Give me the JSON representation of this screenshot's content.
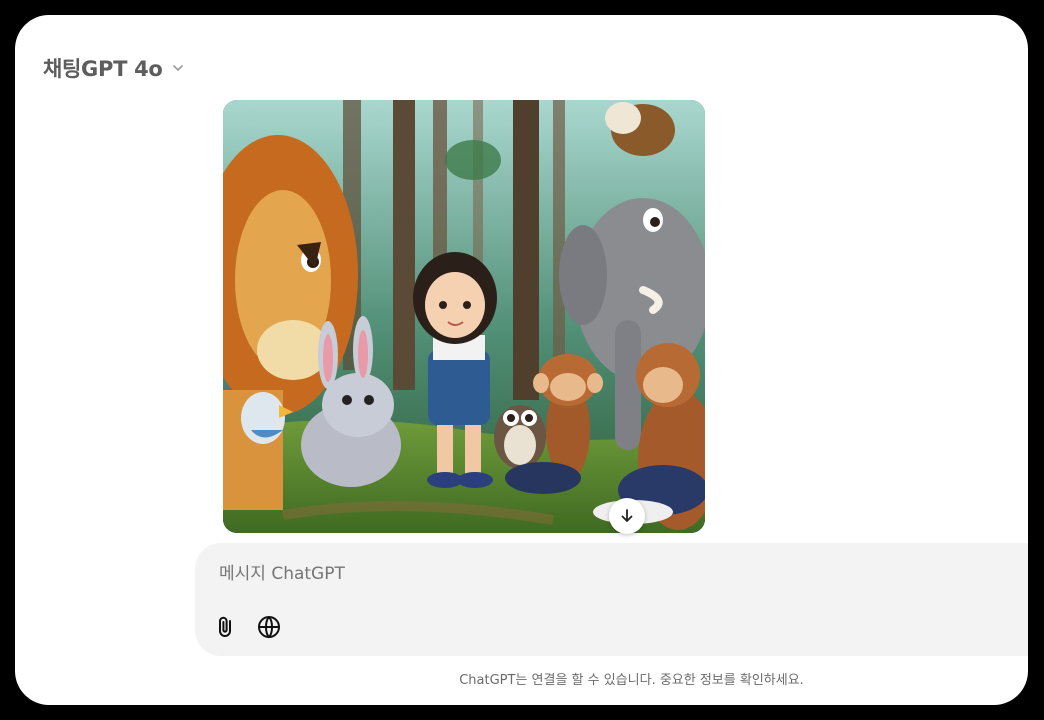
{
  "header": {
    "model_label": "채팅GPT 4o",
    "chevron_icon": "chevron-down-icon"
  },
  "conversation": {
    "image_alt": "Illustrated forest scene with a girl surrounded by cartoon animals",
    "download_icon": "arrow-down-icon"
  },
  "composer": {
    "placeholder": "메시지 ChatGPT",
    "attach_icon": "paperclip-icon",
    "web_icon": "globe-icon"
  },
  "footer": {
    "disclaimer": "ChatGPT는 연결을 할 수 있습니다. 중요한 정보를 확인하세요."
  },
  "colors": {
    "background": "#000000",
    "surface": "#ffffff",
    "composer_bg": "#f3f3f3",
    "muted_text": "#6b6b6b"
  }
}
